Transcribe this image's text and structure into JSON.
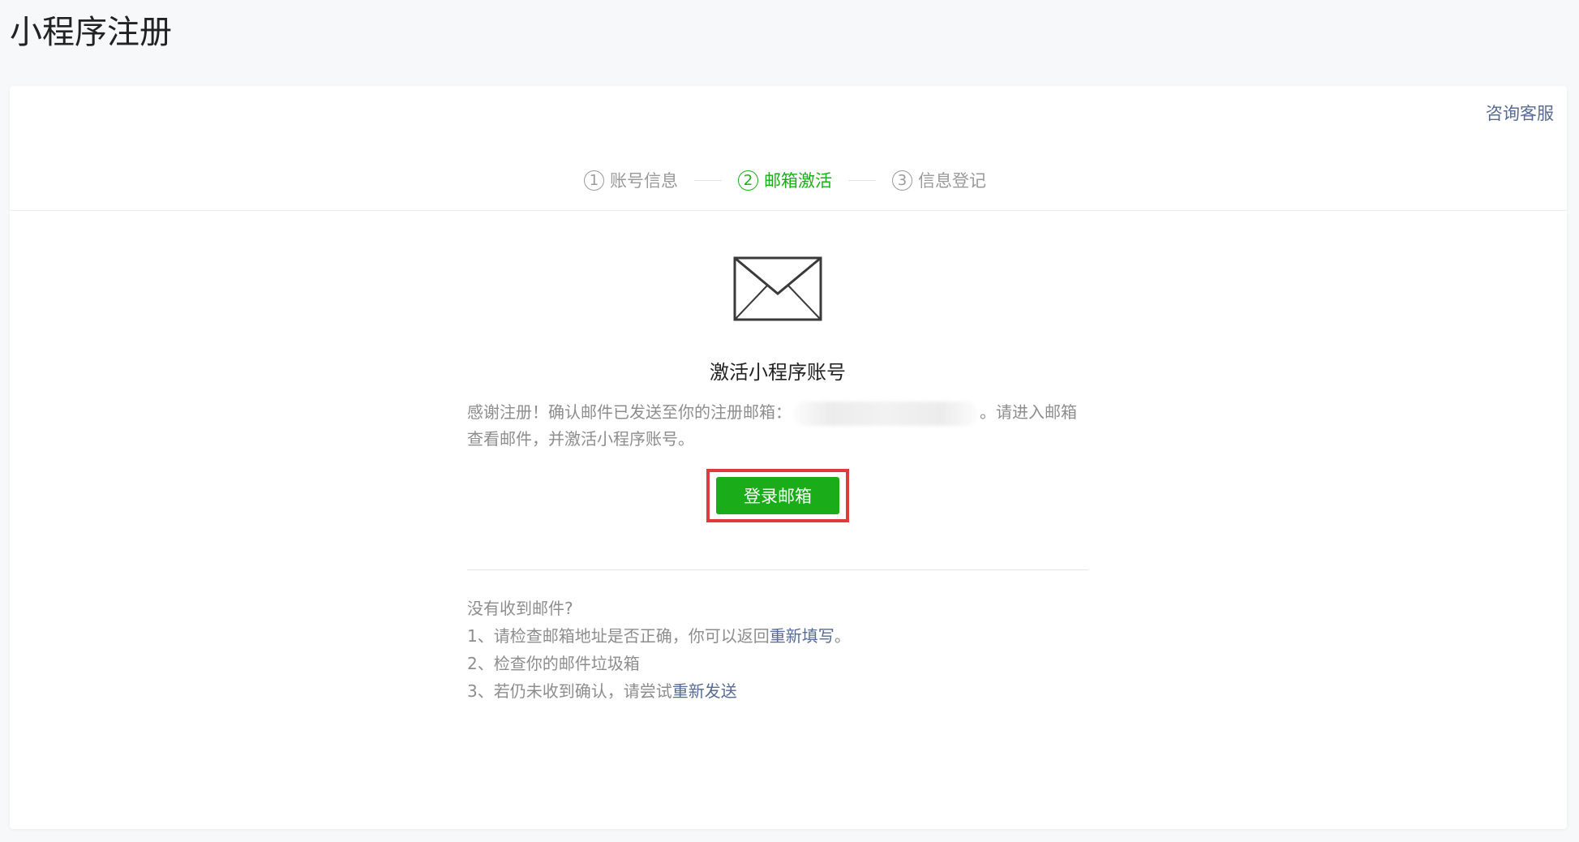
{
  "page": {
    "title": "小程序注册"
  },
  "header": {
    "consult_label": "咨询客服"
  },
  "steps": [
    {
      "num": "1",
      "label": "账号信息",
      "active": false
    },
    {
      "num": "2",
      "label": "邮箱激活",
      "active": true
    },
    {
      "num": "3",
      "label": "信息登记",
      "active": false
    }
  ],
  "content": {
    "icon": "envelope-icon",
    "title": "激活小程序账号",
    "desc_prefix": "感谢注册！确认邮件已发送至你的注册邮箱：",
    "desc_suffix": "。请进入邮箱查看邮件，并激活小程序账号。",
    "login_button": "登录邮箱"
  },
  "help": {
    "heading": "没有收到邮件?",
    "item1_prefix": "1、请检查邮箱地址是否正确，你可以返回",
    "item1_link": "重新填写",
    "item1_suffix": "。",
    "item2": "2、检查你的邮件垃圾箱",
    "item3_prefix": "3、若仍未收到确认，请尝试",
    "item3_link": "重新发送"
  },
  "colors": {
    "accent_green": "#1aad19",
    "link_blue": "#576b95",
    "highlight_red": "#e0393e"
  }
}
